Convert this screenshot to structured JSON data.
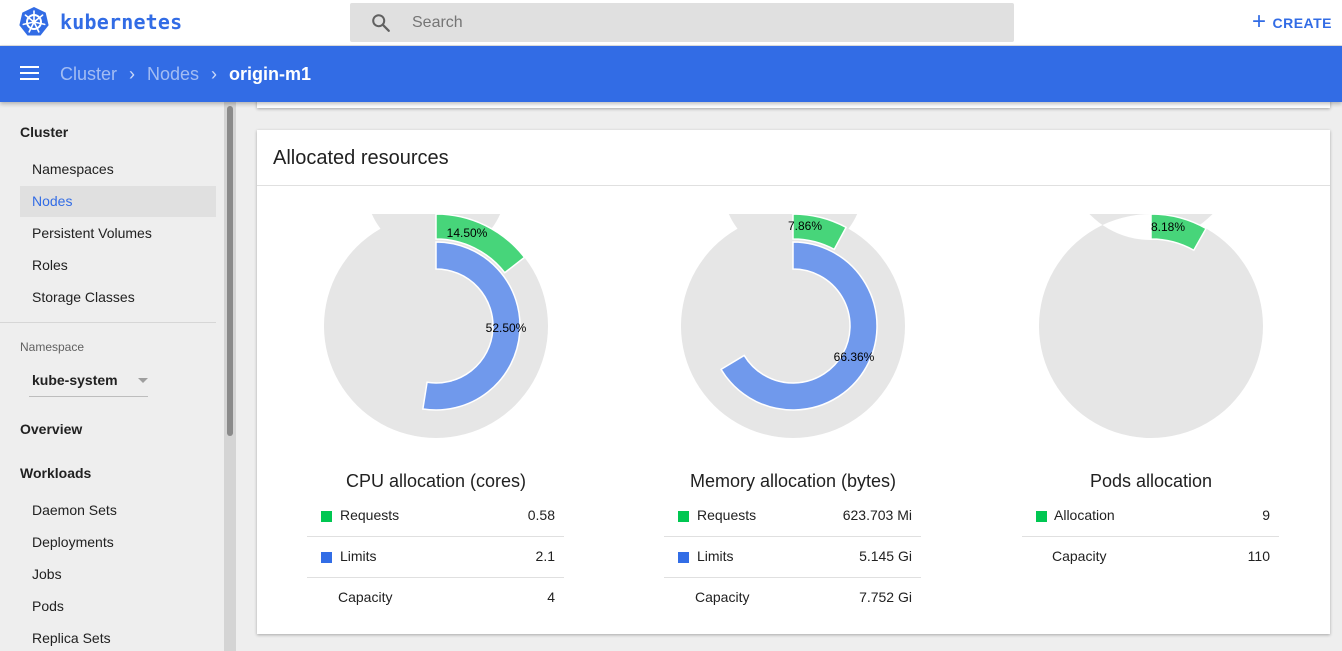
{
  "app": {
    "brand": "kubernetes",
    "brand_color": "#326ce5"
  },
  "search": {
    "placeholder": "Search",
    "value": ""
  },
  "toolbar": {
    "create_label": "CREATE",
    "create_icon": "plus-icon"
  },
  "breadcrumbs": {
    "items": [
      "Cluster",
      "Nodes"
    ],
    "current": "origin-m1"
  },
  "sidebar": {
    "cluster_heading": "Cluster",
    "cluster_items": [
      {
        "label": "Namespaces",
        "active": false
      },
      {
        "label": "Nodes",
        "active": true
      },
      {
        "label": "Persistent Volumes",
        "active": false
      },
      {
        "label": "Roles",
        "active": false
      },
      {
        "label": "Storage Classes",
        "active": false
      }
    ],
    "namespace_label": "Namespace",
    "namespace_value": "kube-system",
    "overview": "Overview",
    "workloads_heading": "Workloads",
    "workload_items": [
      "Daemon Sets",
      "Deployments",
      "Jobs",
      "Pods",
      "Replica Sets"
    ]
  },
  "allocated": {
    "title": "Allocated resources",
    "colors": {
      "requests": "#00c752",
      "limits": "#326de6",
      "outer_arc": "#47d57a",
      "inner_arc": "#7099ec",
      "track": "#e6e6e6"
    },
    "cpu": {
      "title": "CPU allocation (cores)",
      "requests_pct": 14.5,
      "limits_pct": 52.5,
      "requests_pct_label": "14.50%",
      "limits_pct_label": "52.50%",
      "rows": [
        {
          "label": "Requests",
          "value": "0.58",
          "swatch": "requests"
        },
        {
          "label": "Limits",
          "value": "2.1",
          "swatch": "limits"
        },
        {
          "label": "Capacity",
          "value": "4",
          "swatch": ""
        }
      ]
    },
    "memory": {
      "title": "Memory allocation (bytes)",
      "requests_pct": 7.86,
      "limits_pct": 66.36,
      "requests_pct_label": "7.86%",
      "limits_pct_label": "66.36%",
      "rows": [
        {
          "label": "Requests",
          "value": "623.703 Mi",
          "swatch": "requests"
        },
        {
          "label": "Limits",
          "value": "5.145 Gi",
          "swatch": "limits"
        },
        {
          "label": "Capacity",
          "value": "7.752 Gi",
          "swatch": ""
        }
      ]
    },
    "pods": {
      "title": "Pods allocation",
      "allocation_pct": 8.18,
      "allocation_pct_label": "8.18%",
      "rows": [
        {
          "label": "Allocation",
          "value": "9",
          "swatch": "requests"
        },
        {
          "label": "Capacity",
          "value": "110",
          "swatch": ""
        }
      ]
    }
  }
}
